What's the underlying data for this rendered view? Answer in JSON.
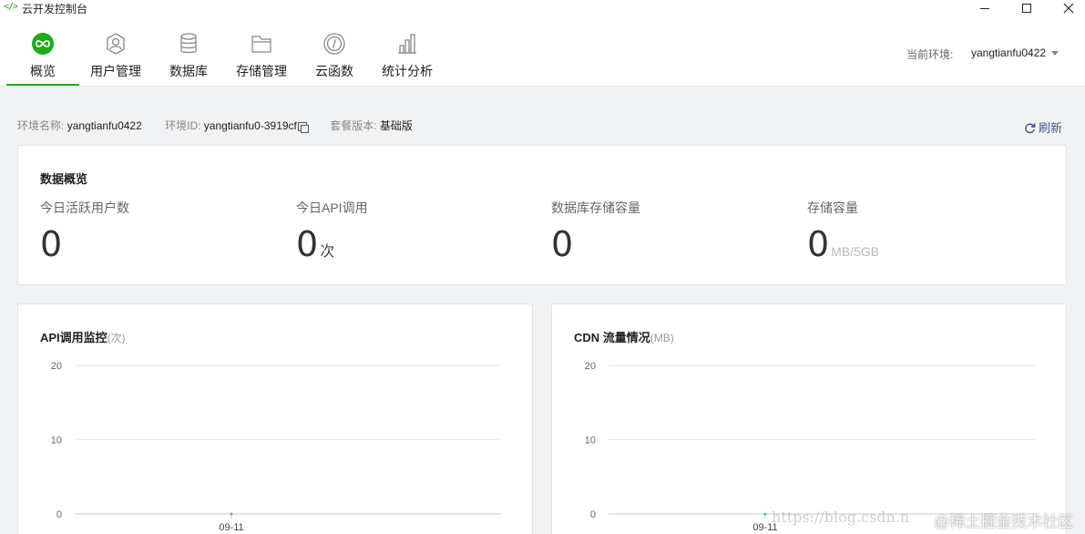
{
  "window": {
    "title": "云开发控制台",
    "icon": "code-brackets-icon"
  },
  "nav": {
    "items": [
      {
        "label": "概览",
        "icon": "infinity-icon",
        "active": true
      },
      {
        "label": "用户管理",
        "icon": "user-icon"
      },
      {
        "label": "数据库",
        "icon": "database-icon"
      },
      {
        "label": "存储管理",
        "icon": "folder-icon"
      },
      {
        "label": "云函数",
        "icon": "function-icon"
      },
      {
        "label": "统计分析",
        "icon": "bar-chart-icon"
      }
    ],
    "env_label": "当前环境:",
    "env_value": "yangtianfu0422"
  },
  "info": {
    "name_key": "环境名称:",
    "name_val": "yangtianfu0422",
    "id_key": "环境ID:",
    "id_val": "yangtianfu0-3919cf",
    "plan_key": "套餐版本:",
    "plan_val": "基础版",
    "refresh": "刷新"
  },
  "overview": {
    "title": "数据概览",
    "stats": [
      {
        "label": "今日活跃用户数",
        "value": "0",
        "unit": ""
      },
      {
        "label": "今日API调用",
        "value": "0",
        "unit": "次"
      },
      {
        "label": "数据库存储容量",
        "value": "0",
        "unit": ""
      },
      {
        "label": "存储容量",
        "value": "0",
        "unit": "MB/5GB"
      }
    ]
  },
  "charts": {
    "api": {
      "title": "API调用监控",
      "unit": "(次)"
    },
    "cdn": {
      "title": "CDN 流量情况",
      "unit": "(MB)"
    }
  },
  "chart_data": [
    {
      "type": "line",
      "title": "API调用监控(次)",
      "x": [
        "09-11"
      ],
      "series": [
        {
          "values": [
            0
          ]
        }
      ],
      "yticks": [
        0,
        10,
        20
      ],
      "ylim": [
        0,
        20
      ],
      "grid": true
    },
    {
      "type": "line",
      "title": "CDN 流量情况(MB)",
      "x": [
        "09-11"
      ],
      "series": [
        {
          "values": [
            0
          ]
        }
      ],
      "yticks": [
        0,
        10,
        20
      ],
      "ylim": [
        0,
        20
      ],
      "grid": true
    }
  ],
  "watermark": "https://blog.csdn.n",
  "watermark2": "@稀土掘金技术社区",
  "colors": {
    "accent": "#1aad19",
    "link": "#3d5a8a"
  }
}
